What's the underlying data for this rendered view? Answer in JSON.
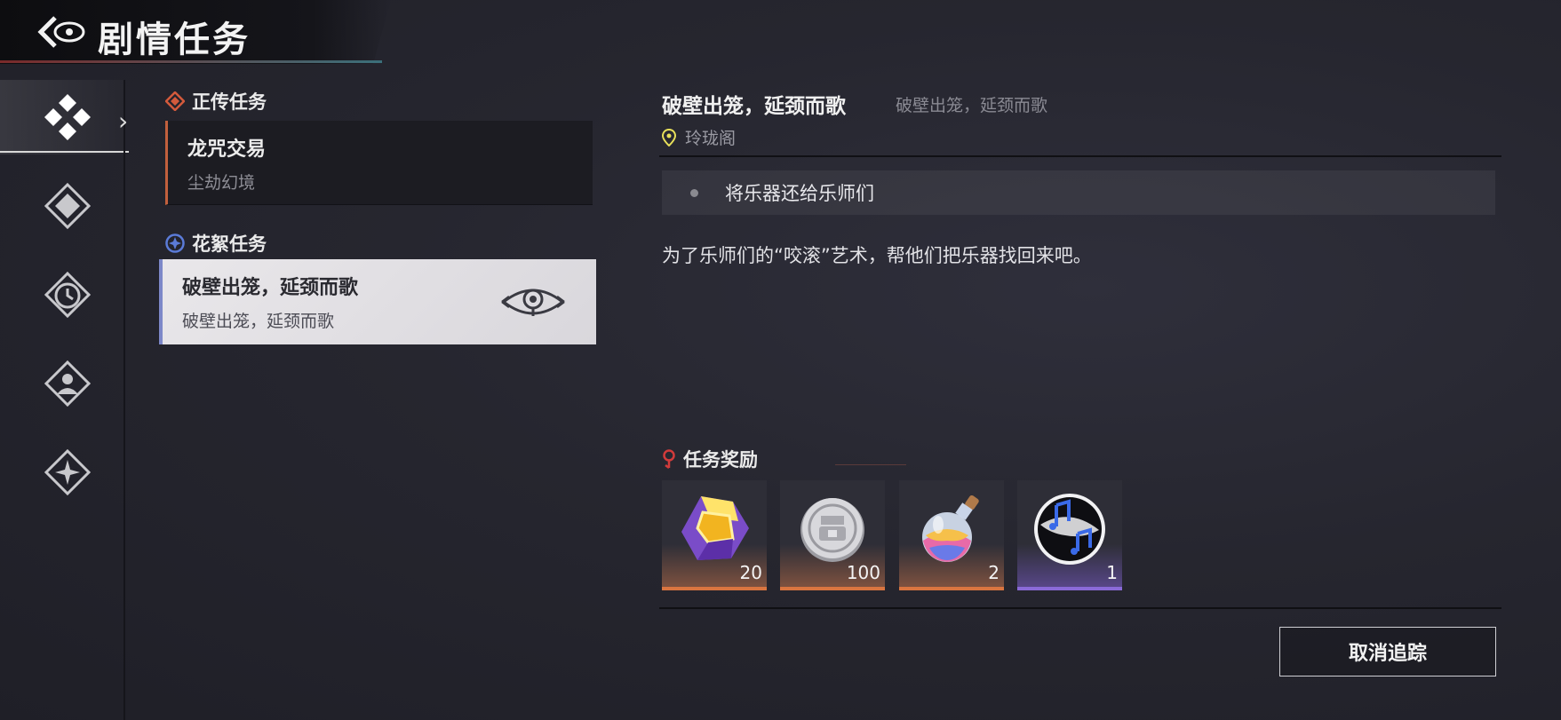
{
  "header": {
    "title": "剧情任务"
  },
  "sections": {
    "main": {
      "title": "正传任务",
      "quests": [
        {
          "name": "龙咒交易",
          "location": "尘劫幻境"
        }
      ]
    },
    "side": {
      "title": "花絮任务",
      "quests": [
        {
          "name": "破壁出笼，延颈而歌",
          "subtitle": "破壁出笼，延颈而歌"
        }
      ]
    }
  },
  "detail": {
    "title": "破壁出笼，延颈而歌",
    "subtitle": "破壁出笼，延颈而歌",
    "location": "玲珑阁",
    "objective": "将乐器还给乐师们",
    "description": "为了乐师们的“咬滚”艺术，帮他们把乐器找回来吧。"
  },
  "rewards": {
    "title": "任务奖励",
    "items": [
      {
        "icon": "gem-icon",
        "count": "20"
      },
      {
        "icon": "coin-icon",
        "count": "100"
      },
      {
        "icon": "potion-icon",
        "count": "2"
      },
      {
        "icon": "music-disc-icon",
        "count": "1"
      }
    ]
  },
  "buttons": {
    "cancel_tracking": "取消追踪"
  },
  "colors": {
    "main_accent": "#c2603d",
    "side_accent": "#7d88c9",
    "reward_orange": "#d97540",
    "reward_purple": "#8a6ad8"
  }
}
